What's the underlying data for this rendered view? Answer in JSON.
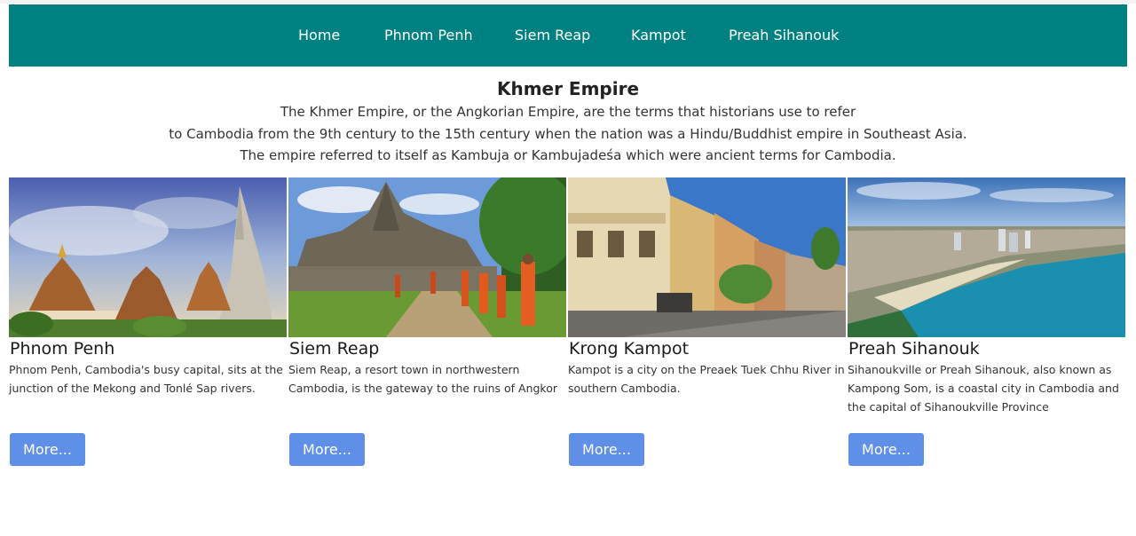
{
  "nav": {
    "items": [
      "Home",
      "Phnom Penh",
      "Siem Reap",
      "Kampot",
      "Preah Sihanouk"
    ]
  },
  "header": {
    "title": "Khmer Empire",
    "lines": [
      "The Khmer Empire, or the Angkorian Empire, are the terms that historians use to refer",
      "to Cambodia from the 9th century to the 15th century when the nation was a Hindu/Buddhist empire in Southeast Asia.",
      "The empire referred to itself as Kambuja or Kambujadeśa which were ancient terms for Cambodia."
    ]
  },
  "cards": [
    {
      "title": "Phnom Penh",
      "text": "Phnom Penh, Cambodia's busy capital, sits at the junction of the Mekong and Tonlé Sap rivers.",
      "button": "More...",
      "image": "royal-palace-stupa-photo"
    },
    {
      "title": "Siem Reap",
      "text": "Siem Reap, a resort town in northwestern Cambodia, is the gateway to the ruins of Angkor",
      "button": "More...",
      "image": "bayon-temple-monks-photo"
    },
    {
      "title": "Krong Kampot",
      "text": "Kampot is a city on the Preaek Tuek Chhu River in southern Cambodia.",
      "button": "More...",
      "image": "colonial-street-photo"
    },
    {
      "title": "Preah Sihanouk",
      "text": "Sihanoukville or Preah Sihanouk, also known as Kampong Som, is a coastal city in Cambodia and the capital of Sihanoukville Province",
      "button": "More...",
      "image": "coastal-city-aerial-photo"
    }
  ],
  "colors": {
    "nav_bg": "#008080",
    "button_bg": "#5f8fe6"
  }
}
